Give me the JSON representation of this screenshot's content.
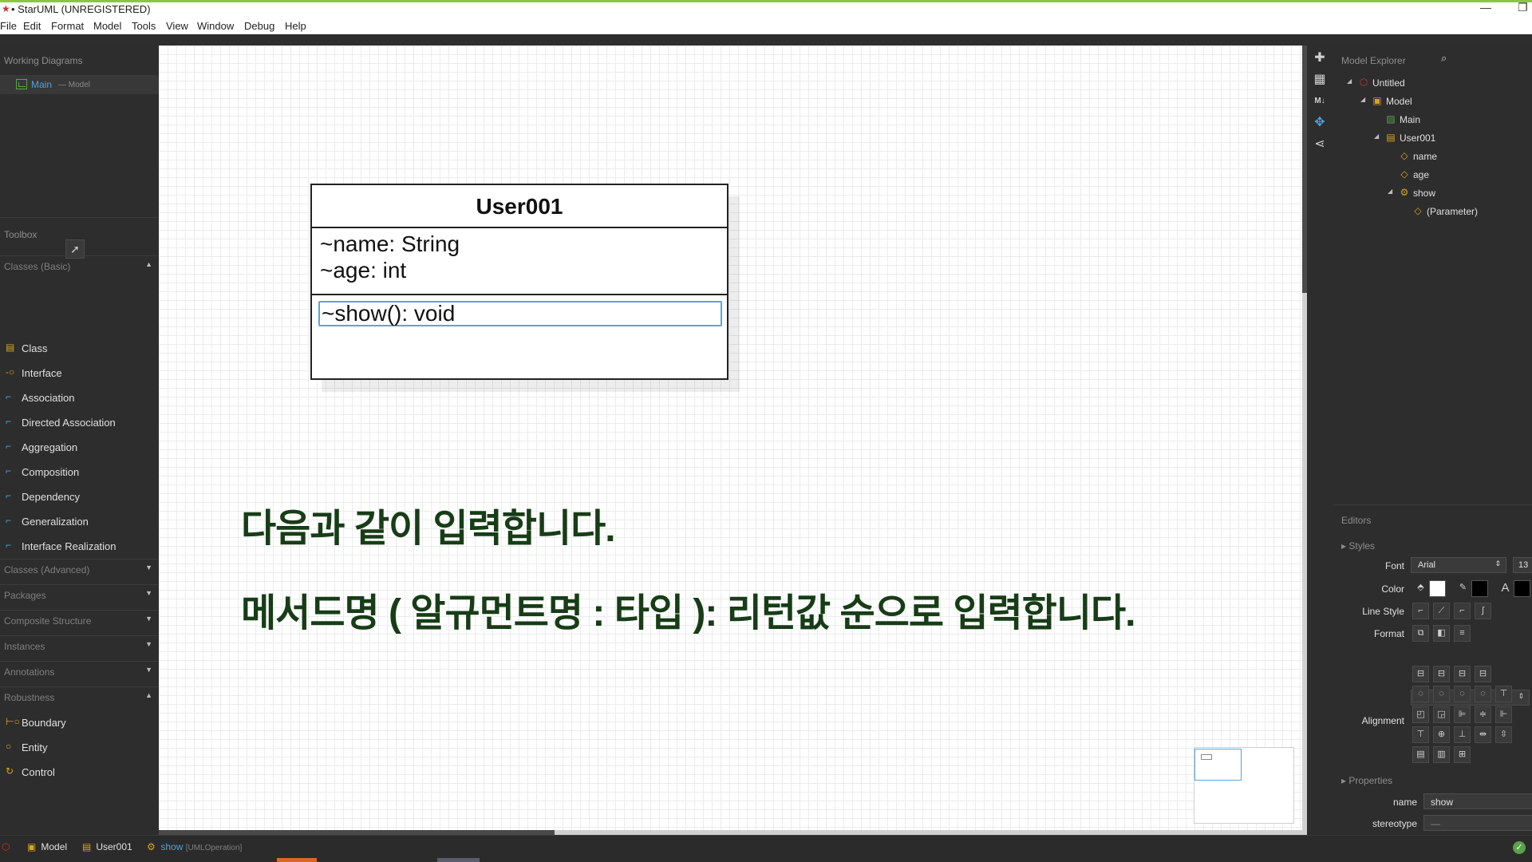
{
  "window": {
    "title": "• StarUML (UNREGISTERED)",
    "logo": "staruml-logo",
    "controls": {
      "minimize": "—",
      "restore": "❐"
    }
  },
  "menu": [
    "File",
    "Edit",
    "Format",
    "Model",
    "Tools",
    "View",
    "Window",
    "Debug",
    "Help"
  ],
  "working_diagrams": {
    "header": "Working Diagrams",
    "item": {
      "label": "Main",
      "sub": "— Model",
      "icon": "diagram-icon"
    }
  },
  "toolbox": {
    "header": "Toolbox",
    "pointer_icon": "pointer-icon",
    "sections": [
      {
        "title": "Classes (Basic)",
        "arrow": "▲",
        "items": [
          {
            "label": "Class",
            "icon": "class-icon"
          },
          {
            "label": "Interface",
            "icon": "interface-icon"
          },
          {
            "label": "Association",
            "icon": "association-icon"
          },
          {
            "label": "Directed Association",
            "icon": "directed-association-icon"
          },
          {
            "label": "Aggregation",
            "icon": "aggregation-icon"
          },
          {
            "label": "Composition",
            "icon": "composition-icon"
          },
          {
            "label": "Dependency",
            "icon": "dependency-icon"
          },
          {
            "label": "Generalization",
            "icon": "generalization-icon"
          },
          {
            "label": "Interface Realization",
            "icon": "interface-realization-icon"
          }
        ]
      },
      {
        "title": "Classes (Advanced)",
        "arrow": "▼",
        "items": []
      },
      {
        "title": "Packages",
        "arrow": "▼",
        "items": []
      },
      {
        "title": "Composite Structure",
        "arrow": "▼",
        "items": []
      },
      {
        "title": "Instances",
        "arrow": "▼",
        "items": []
      },
      {
        "title": "Annotations",
        "arrow": "▼",
        "items": []
      },
      {
        "title": "Robustness",
        "arrow": "▲",
        "items": [
          {
            "label": "Boundary",
            "icon": "boundary-icon"
          },
          {
            "label": "Entity",
            "icon": "entity-icon"
          },
          {
            "label": "Control",
            "icon": "control-icon"
          }
        ]
      }
    ]
  },
  "diagram": {
    "class_name": "User001",
    "attributes": [
      "~name: String",
      "~age: int"
    ],
    "operation_edit_value": "~show(): void"
  },
  "captions": [
    "다음과 같이 입력합니다.",
    "메서드명 (  알규먼트명 : 타입  ): 리턴값 순으로 입력합니다."
  ],
  "toolstrip": [
    "extensions-icon",
    "palette-icon",
    "markdown-icon",
    "navigate-icon",
    "share-icon"
  ],
  "model_explorer": {
    "header": "Model Explorer",
    "search_icon": "search-icon",
    "tree": [
      {
        "label": "Untitled",
        "icon": "project-icon",
        "twisty": "◢",
        "level": 0
      },
      {
        "label": "Model",
        "icon": "model-icon",
        "twisty": "◢",
        "level": 1
      },
      {
        "label": "Main",
        "icon": "diagram-icon",
        "twisty": "",
        "level": 2
      },
      {
        "label": "User001",
        "icon": "class-icon",
        "twisty": "◢",
        "level": 2
      },
      {
        "label": "name",
        "icon": "attribute-icon",
        "twisty": "",
        "level": 3
      },
      {
        "label": "age",
        "icon": "attribute-icon",
        "twisty": "",
        "level": 3
      },
      {
        "label": "show",
        "icon": "operation-icon",
        "twisty": "◢",
        "level": 3
      },
      {
        "label": "(Parameter)",
        "icon": "parameter-icon",
        "twisty": "",
        "level": 4
      }
    ]
  },
  "editors": {
    "header": "Editors",
    "styles_label": "Styles",
    "font_label": "Font",
    "font_value": "Arial",
    "font_size": "13",
    "color_label": "Color",
    "line_style_label": "Line Style",
    "format_label": "Format",
    "alignment_label": "Alignment",
    "properties_label": "Properties",
    "name_label": "name",
    "name_value": "show",
    "stereotype_label": "stereotype",
    "stereotype_value": "—",
    "colors": {
      "fill": "#ffffff",
      "line": "#000000",
      "font": "#000000"
    }
  },
  "statusbar": {
    "items": [
      {
        "label": "Model",
        "icon": "model-icon"
      },
      {
        "label": "User001",
        "icon": "class-icon"
      },
      {
        "label": "show",
        "type": "[UMLOperation]",
        "icon": "operation-icon"
      }
    ],
    "ok_icon": "check-icon"
  }
}
